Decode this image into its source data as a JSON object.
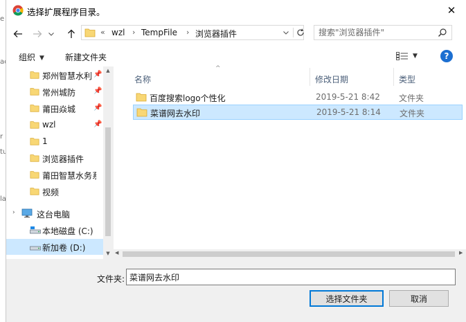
{
  "background_window": {
    "edge_letters": [
      "e",
      "ac",
      "r",
      "tu",
      "la"
    ]
  },
  "titlebar": {
    "title": "选择扩展程序目录。",
    "close_glyph": "✕"
  },
  "address": {
    "overflow": "«",
    "crumbs": [
      "wzl",
      "TempFile",
      "浏览器插件"
    ],
    "separator": "›"
  },
  "search": {
    "placeholder": "搜索\"浏览器插件\""
  },
  "commandbar": {
    "organize_label": "组织",
    "new_folder_label": "新建文件夹",
    "help_glyph": "?"
  },
  "navigation_pane": {
    "quick_access": [
      {
        "label": "郑州智慧水利",
        "pinned": true
      },
      {
        "label": "常州城防",
        "pinned": true
      },
      {
        "label": "莆田焱城",
        "pinned": true
      },
      {
        "label": "wzl",
        "pinned": true
      },
      {
        "label": "1",
        "pinned": false
      },
      {
        "label": "浏览器插件",
        "pinned": false
      },
      {
        "label": "莆田智慧水务系统",
        "pinned": false
      },
      {
        "label": "视频",
        "pinned": false
      }
    ],
    "this_pc_label": "这台电脑",
    "drives": [
      {
        "label": "本地磁盘 (C:)",
        "selected": false
      },
      {
        "label": "新加卷 (D:)",
        "selected": true
      }
    ]
  },
  "file_list": {
    "columns": {
      "name": "名称",
      "date": "修改日期",
      "type": "类型"
    },
    "rows": [
      {
        "name": "百度搜索logo个性化",
        "date": "2019-5-21 8:42",
        "type": "文件夹",
        "selected": false
      },
      {
        "name": "菜谱网去水印",
        "date": "2019-5-21 8:14",
        "type": "文件夹",
        "selected": true
      }
    ]
  },
  "footer": {
    "folder_label": "文件夹:",
    "folder_value": "菜谱网去水印",
    "select_button": "选择文件夹",
    "cancel_button": "取消"
  },
  "colors": {
    "selection_bg": "#cce8ff",
    "selection_border": "#99d1ff",
    "folder_yellow": "#f8d775",
    "accent_blue": "#0078d7",
    "header_text": "#4c607a"
  }
}
